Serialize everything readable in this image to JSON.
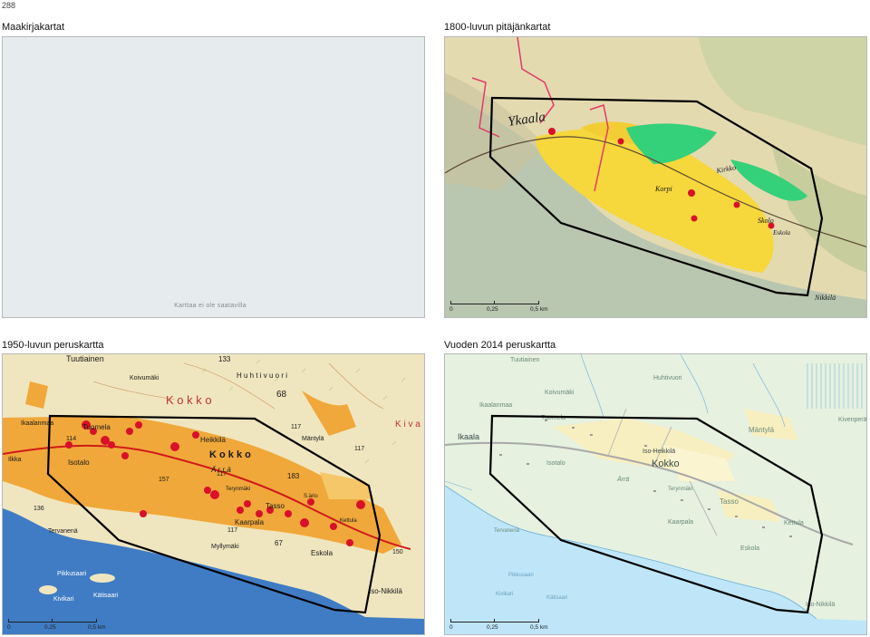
{
  "page_number": "288",
  "panels": {
    "p1": {
      "title": "Maakirjakartat",
      "unavailable": "Karttaa ei ole saatavilla"
    },
    "p2": {
      "title": "1800-luvun pitäjänkartat",
      "labels": {
        "ykaala": "Ykaala",
        "korpi": "Korpi",
        "skolo": "Skolo",
        "eskola": "Eskola",
        "nikkila": "Nikkilä",
        "kirkko": "Kirkko"
      }
    },
    "p3": {
      "title": "1950-luvun peruskartta",
      "labels": {
        "tuutiainen": "Tuutiainen",
        "koivumaki": "Koivumäki",
        "kokko_top": "K o k k o",
        "n68": "68",
        "n133": "133",
        "huhtivuori": "H u h t i v u o r i",
        "kiva": "K i v a",
        "ikaalanmaa": "Ikaalanmaa",
        "tuomela": "Tuomela",
        "heikkila": "Heikkilä",
        "kokko": "K o k k o",
        "mantyla": "Mäntylä",
        "n114": "114",
        "n117a": "117",
        "n117b": "117",
        "n117c": "117",
        "n117d": "117",
        "isotalo": "Isotalo",
        "ilkka": "Ilkka",
        "arra": "Ä r r ä",
        "n183": "183",
        "terynmaki": "Terynmäki",
        "saario": "S.ärio",
        "tasso": "Tasso",
        "kettula": "Kettula",
        "kaarpala": "Kaarpala",
        "eskola": "Eskola",
        "myllymaki": "Myllymäki",
        "n67": "67",
        "tervanena": "Tervanenä",
        "pikkusaari": "Pikkusaari",
        "kivikari": "Kivikari",
        "katisaari": "Kätisaari",
        "isonikkila": "Iso-Nikkilä",
        "n136": "136",
        "n157": "157",
        "n150": "150"
      }
    },
    "p4": {
      "title": "Vuoden 2014 peruskartta",
      "labels": {
        "tuutiainen": "Tuutiainen",
        "koivumaki": "Koivumäki",
        "huhtivuori": "Huhtivuori",
        "ikaalanmaa": "Ikaalanmaa",
        "tuomela": "Tuomela",
        "mantyla": "Mäntylä",
        "kivenpera": "Kivenperä",
        "ikaala": "Ikaala",
        "isoheikkila": "Iso-Heikkilä",
        "isotalo": "Isotalo",
        "kokko": "Kokko",
        "arra": "Ärrä",
        "terynmaki": "Terynmäki",
        "tasso": "Tasso",
        "kaarpala": "Kaarpala",
        "kettula": "Kettula",
        "tervanenä": "Tervanenä",
        "eskola": "Eskola",
        "isonikkila": "Iso-Nikkilä",
        "pikkusaari": "Pikkusaari",
        "kivikari": "Kivikari",
        "katisaari": "Kätisaari"
      }
    }
  },
  "scale_labels": {
    "zero": "0",
    "mid": "0,25",
    "end": "0,5 km"
  },
  "colors": {
    "outline": "#000000",
    "marker": "#d8102a",
    "water_old": "#3f7cc4",
    "water_new": "#bfe6f8",
    "settlement_old": "#f0a83a",
    "field_yellow": "#f6d73c",
    "field_green": "#35d07a",
    "paper": "#efe6bf"
  }
}
